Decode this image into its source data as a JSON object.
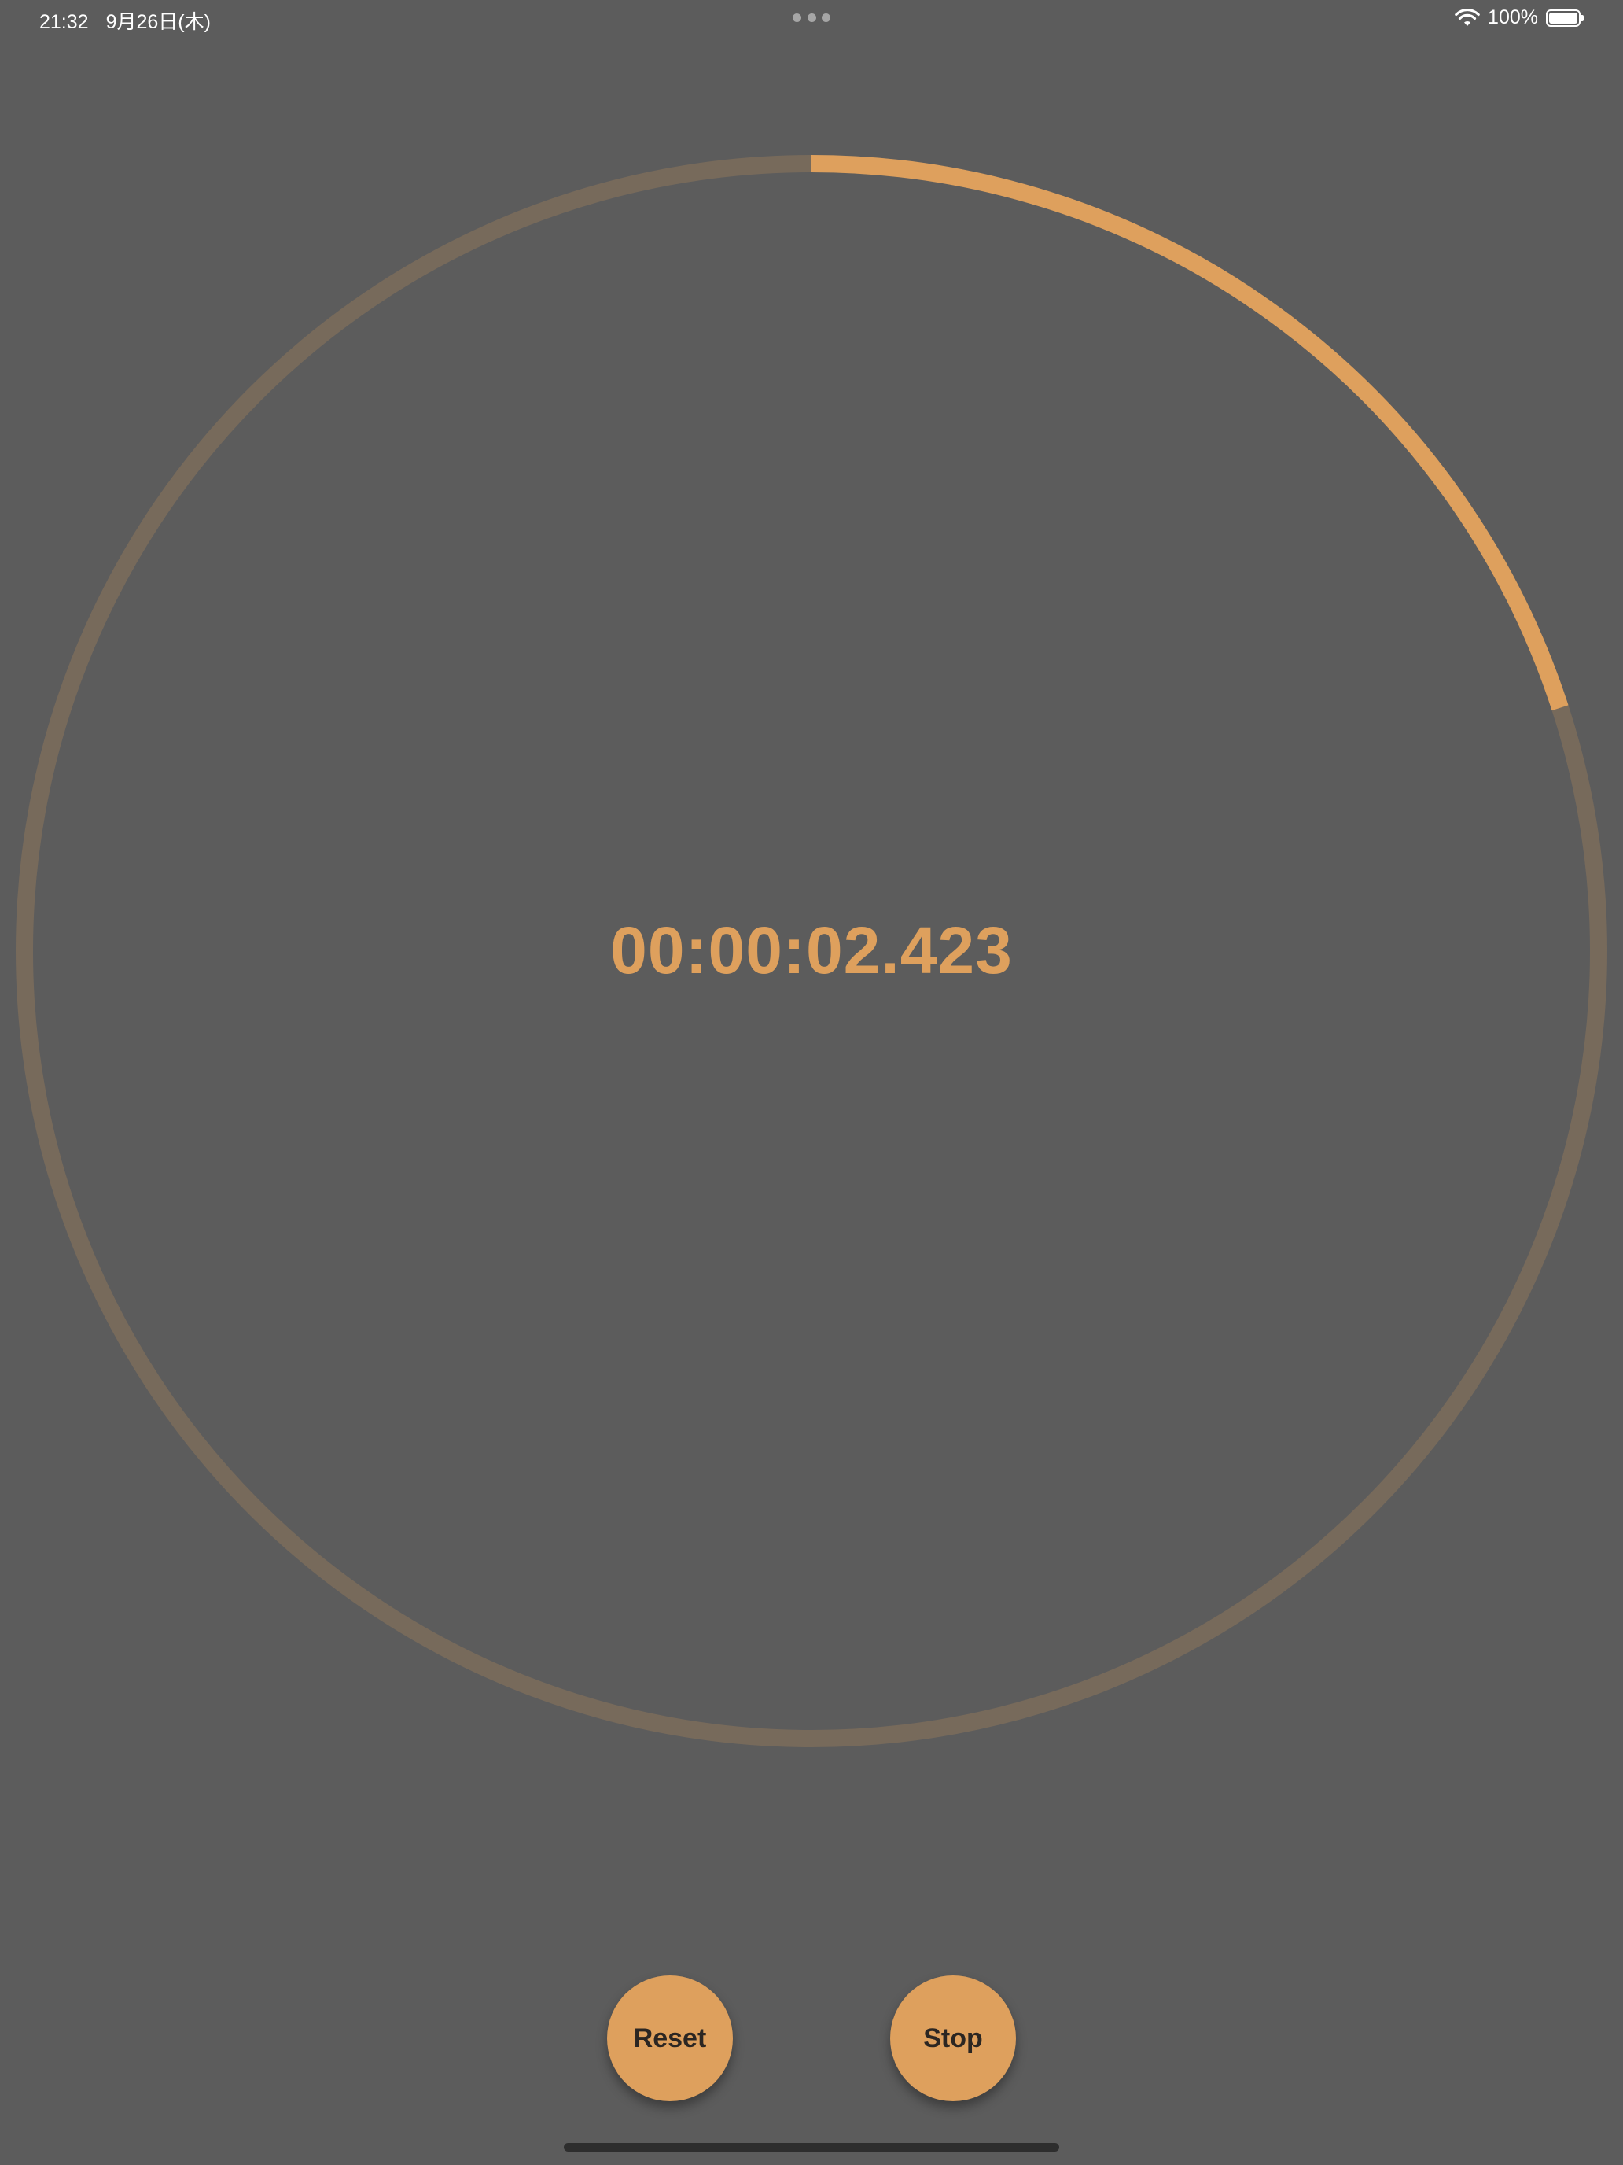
{
  "status_bar": {
    "time": "21:32",
    "date": "9月26日(木)",
    "battery_percent": "100%",
    "battery_level": 1.0,
    "wifi_icon": "wifi-icon",
    "battery_icon": "battery-icon"
  },
  "stopwatch": {
    "elapsed": "00:00:02.423",
    "ring_progress": 0.2
  },
  "controls": {
    "reset_label": "Reset",
    "stop_label": "Stop"
  },
  "colors": {
    "background": "#5c5c5c",
    "accent": "#dea05d",
    "ring_track": "#776a5b",
    "button_text": "#2b2622"
  }
}
